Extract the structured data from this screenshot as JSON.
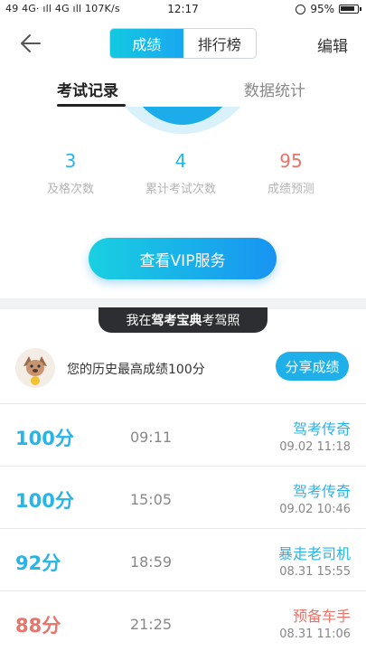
{
  "status": {
    "left": "49 4G· ıll 4G ıll 107K/s",
    "time": "12:17",
    "battery": "95%"
  },
  "nav": {
    "seg_scores": "成绩",
    "seg_ranking": "排行榜",
    "edit": "编辑"
  },
  "tabs": {
    "exam_records": "考试记录",
    "data_stats": "数据统计"
  },
  "stats": [
    {
      "value": "3",
      "label": "及格次数",
      "color": "#27b4e8"
    },
    {
      "value": "4",
      "label": "累计考试次数",
      "color": "#27b4e8"
    },
    {
      "value": "95",
      "label": "成绩预测",
      "color": "#e8736a"
    }
  ],
  "vip_button": "查看VIP服务",
  "banner": {
    "prefix": "我在",
    "brand": "驾考宝典",
    "suffix": "考驾照"
  },
  "best": {
    "text": "您的历史最高成绩100分",
    "share": "分享成绩"
  },
  "records": [
    {
      "score": "100分",
      "time": "09:11",
      "title": "驾考传奇",
      "date": "09.02  11:18",
      "color": "#27b4e8"
    },
    {
      "score": "100分",
      "time": "15:05",
      "title": "驾考传奇",
      "date": "09.02  10:46",
      "color": "#27b4e8"
    },
    {
      "score": "92分",
      "time": "18:59",
      "title": "暴走老司机",
      "date": "08.31  15:55",
      "color": "#27b4e8"
    },
    {
      "score": "88分",
      "time": "21:25",
      "title": "预备车手",
      "date": "08.31  11:06",
      "color": "#e8736a"
    }
  ]
}
